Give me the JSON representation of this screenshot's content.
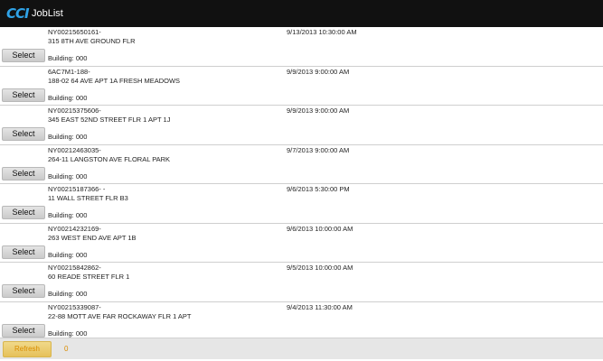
{
  "app": {
    "logo_text": "CCI",
    "title": "JobList"
  },
  "jobs": [
    {
      "job_id": "NY00215650161-",
      "address": "315 8TH AVE GROUND FLR",
      "datetime": "9/13/2013 10:30:00 AM",
      "building": "Building: 000",
      "select_label": "Select"
    },
    {
      "job_id": "6AC7M1-188-",
      "address": "188-02 64 AVE APT 1A FRESH MEADOWS",
      "datetime": "9/9/2013 9:00:00 AM",
      "building": "Building: 000",
      "select_label": "Select"
    },
    {
      "job_id": "NY00215375606-",
      "address": "345 EAST 52ND STREET FLR 1 APT 1J",
      "datetime": "9/9/2013 9:00:00 AM",
      "building": "Building: 000",
      "select_label": "Select"
    },
    {
      "job_id": "NY00212463035-",
      "address": "264-11 LANGSTON AVE FLORAL PARK",
      "datetime": "9/7/2013 9:00:00 AM",
      "building": "Building: 000",
      "select_label": "Select"
    },
    {
      "job_id": "NY00215187366- -",
      "address": "11 WALL STREET FLR B3",
      "datetime": "9/6/2013 5:30:00 PM",
      "building": "Building: 000",
      "select_label": "Select"
    },
    {
      "job_id": "NY00214232169-",
      "address": "263 WEST END AVE APT 1B",
      "datetime": "9/6/2013 10:00:00 AM",
      "building": "Building: 000",
      "select_label": "Select"
    },
    {
      "job_id": "NY00215842862-",
      "address": "60 READE STREET FLR 1",
      "datetime": "9/5/2013 10:00:00 AM",
      "building": "Building: 000",
      "select_label": "Select"
    },
    {
      "job_id": "NY00215339087-",
      "address": "22-88 MOTT AVE FAR ROCKAWAY FLR 1 APT",
      "datetime": "9/4/2013 11:30:00 AM",
      "building": "Building: 000",
      "select_label": "Select"
    }
  ],
  "footer": {
    "refresh_label": "Refresh",
    "count_text": "0"
  }
}
